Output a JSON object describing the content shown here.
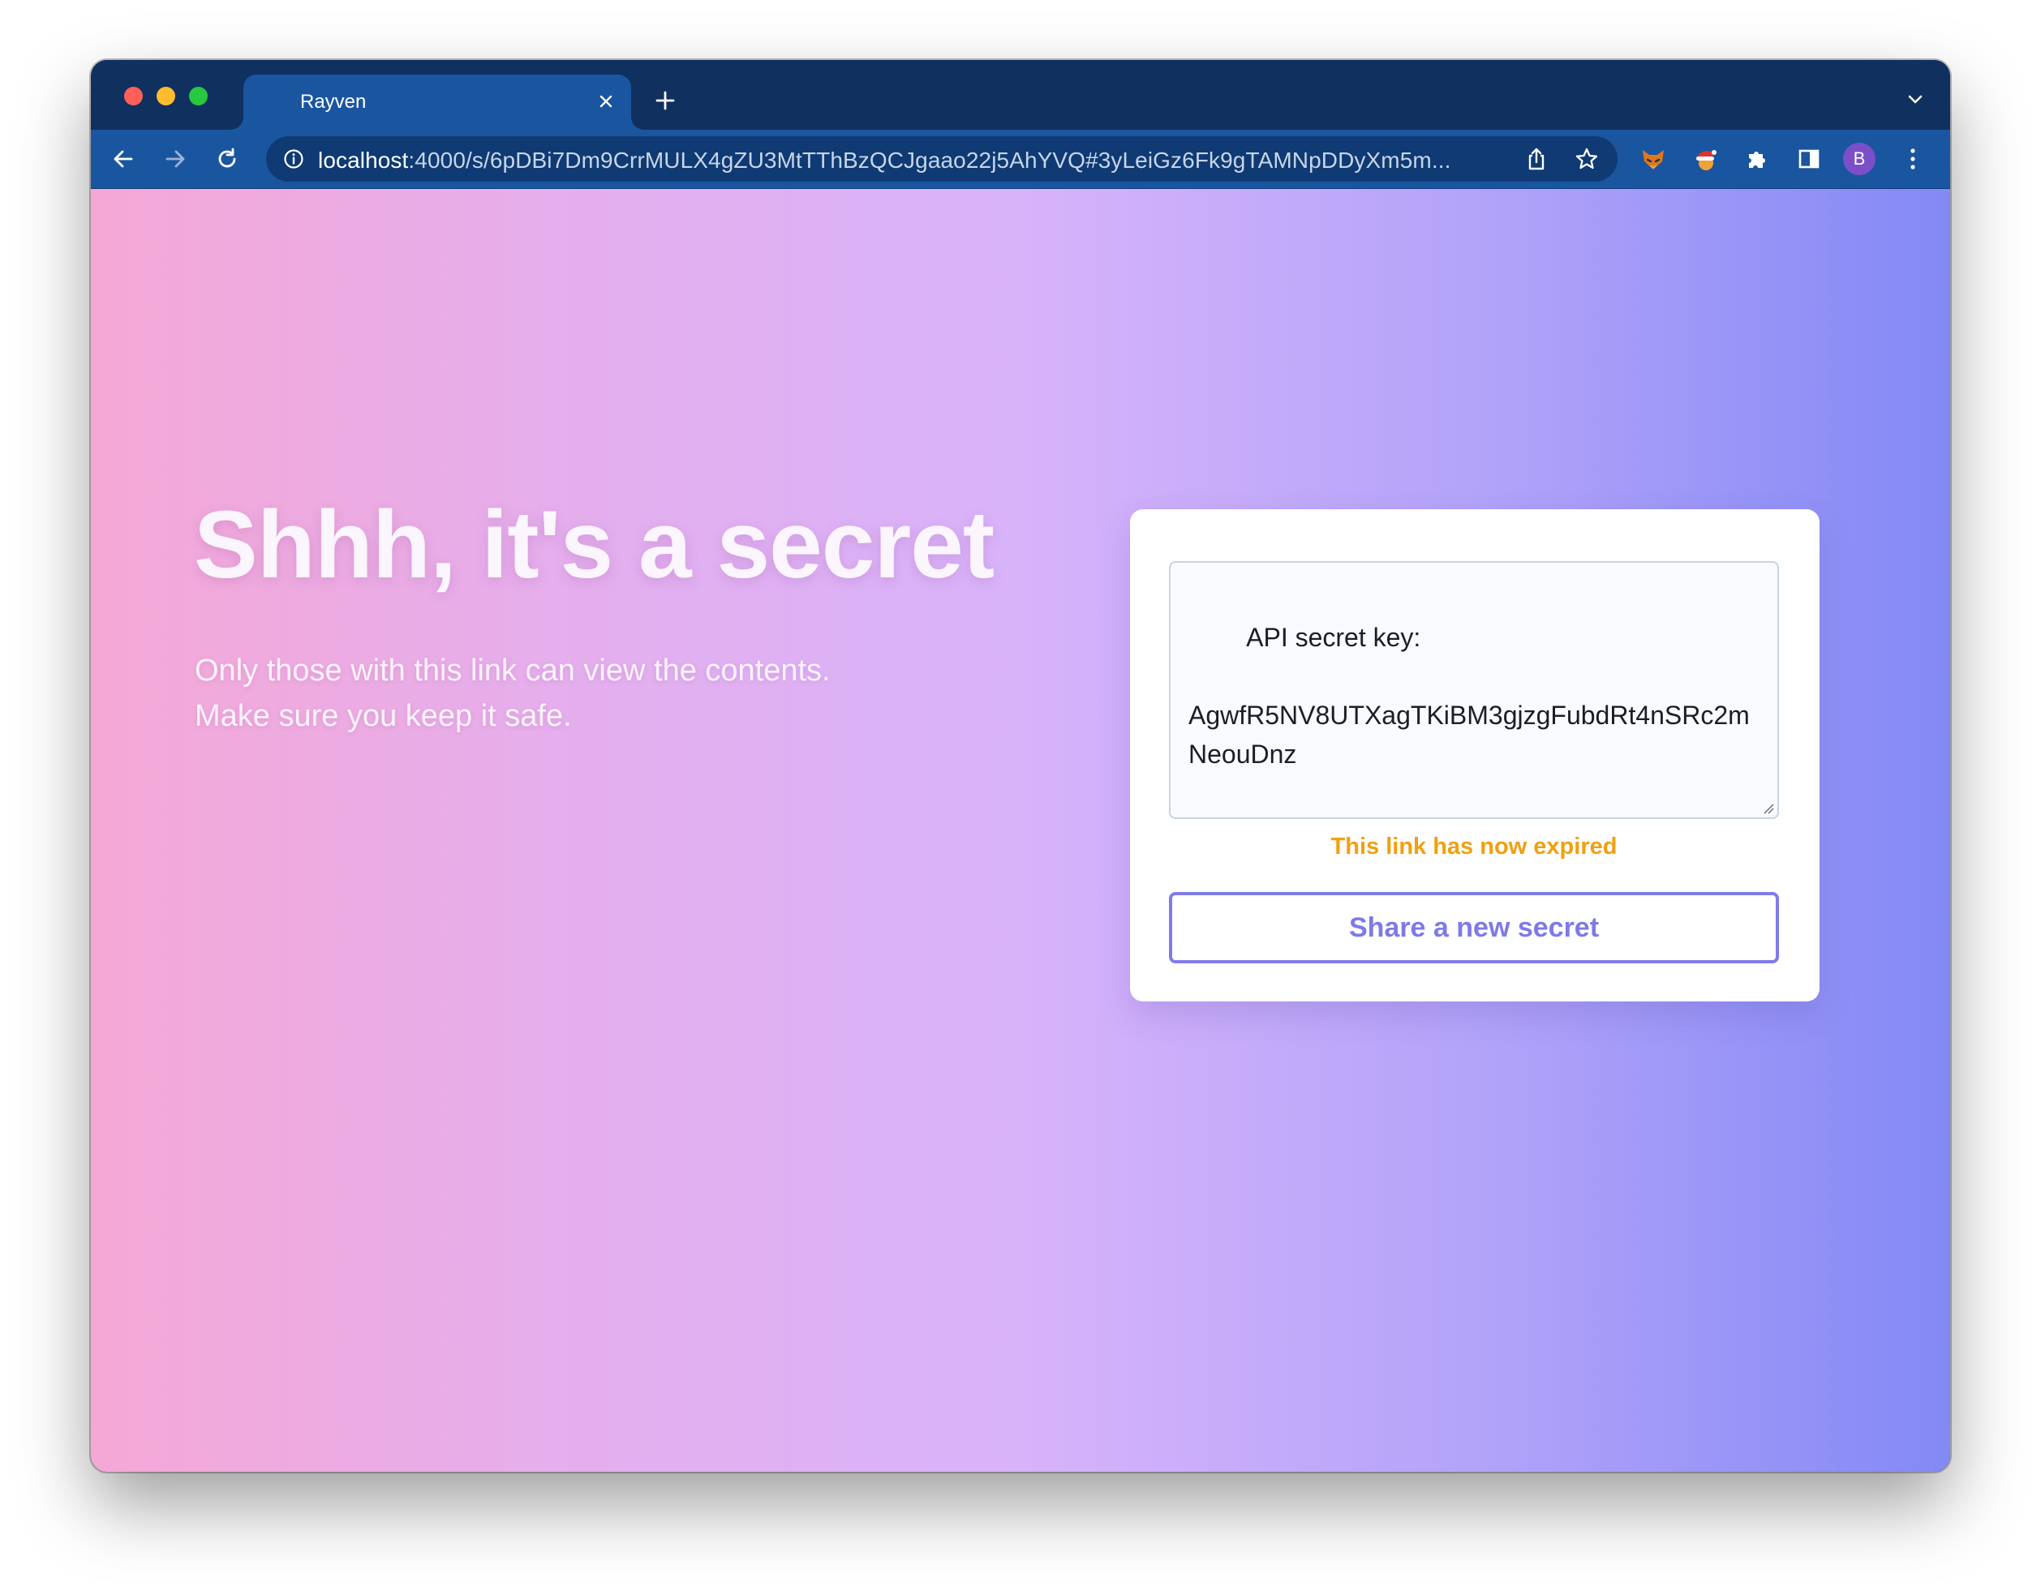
{
  "browser": {
    "tab": {
      "title": "Rayven"
    },
    "address_bar": {
      "host": "localhost",
      "path": ":4000/s/6pDBi7Dm9CrrMULX4gZU3MtTThBzQCJgaao22j5AhYVQ#3yLeiGz6Fk9gTAMNpDDyXm5m..."
    },
    "profile_initial": "B",
    "extensions": [
      "fox-extension-icon",
      "santa-hat-extension-icon",
      "puzzle-icon"
    ]
  },
  "page": {
    "headline": "Shhh, it's a secret",
    "subtext_line1": "Only those with this link can view the contents.",
    "subtext_line2": "Make sure you keep it safe.",
    "secret_text": "API secret key:\n\nAgwfR5NV8UTXagTKiBM3gjzgFubdRt4nSRc2mNeouDnz",
    "status_message": "This link has now expired",
    "share_button_label": "Share a new secret"
  },
  "colors": {
    "titlebar": "#10305f",
    "toolbar": "#1a56a0",
    "gradient_start": "#f5a8d6",
    "gradient_mid": "#d8b3fa",
    "gradient_end": "#8389f5",
    "expired_text": "#f0a010",
    "button_accent": "#7f7cea"
  }
}
